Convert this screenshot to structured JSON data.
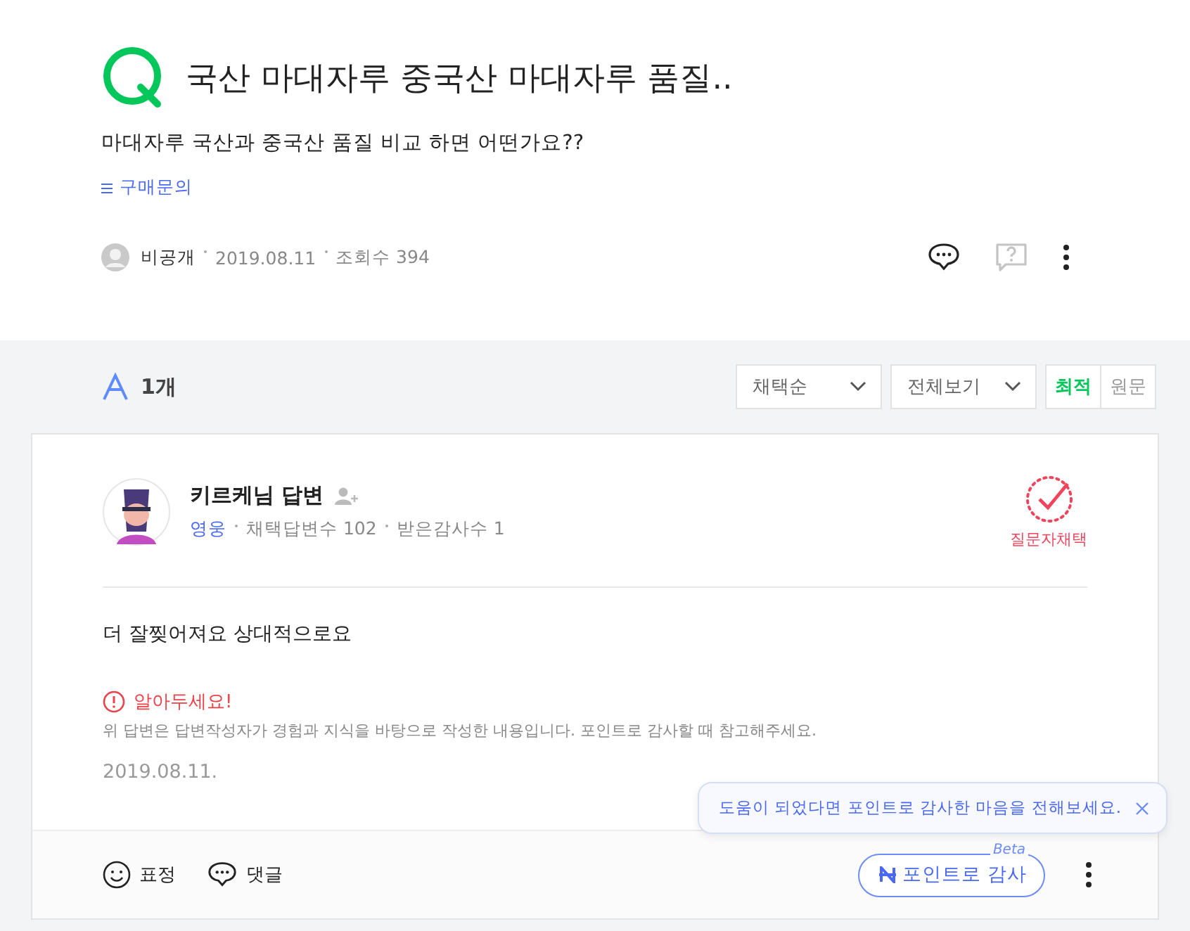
{
  "question": {
    "title": "국산 마대자루 중국산 마대자루 품질..",
    "body": "마대자루 국산과 중국산 품질 비교 하면 어떤가요??",
    "category": "구매문의",
    "author": "비공개",
    "date": "2019.08.11",
    "views": "조회수 394",
    "actions": [
      {
        "kind": "comment",
        "disabled": false
      },
      {
        "kind": "report",
        "disabled": true
      },
      {
        "kind": "more",
        "disabled": false
      }
    ]
  },
  "answers_header": {
    "count": "1개",
    "sorts": [
      {
        "label": "채택순"
      },
      {
        "label": "전체보기"
      }
    ],
    "view_toggle": [
      {
        "label": "최적",
        "selected": true
      },
      {
        "label": "원문",
        "selected": false
      }
    ]
  },
  "answer": {
    "author": "키르케님 답변",
    "grade": "영웅",
    "stats": [
      "채택답변수 102",
      "받은감사수 1"
    ],
    "badge": "질문자채택",
    "body": "더 잘찢어져요 상대적으로요",
    "notice_title": "알아두세요!",
    "notice_text": "위 답변은 답변작성자가 경험과 지식을 바탕으로 작성한 내용입니다. 포인트로 감사할 때 참고해주세요.",
    "date": "2019.08.11.",
    "reactions": [
      {
        "kind": "emotion",
        "label": "표정"
      },
      {
        "kind": "comment",
        "label": "댓글"
      }
    ],
    "thanks_button": {
      "label": "포인트로 감사",
      "tag": "Beta"
    },
    "tooltip": {
      "text": "도움이 되었다면 포인트로 감사한 마음을 전해보세요."
    }
  }
}
